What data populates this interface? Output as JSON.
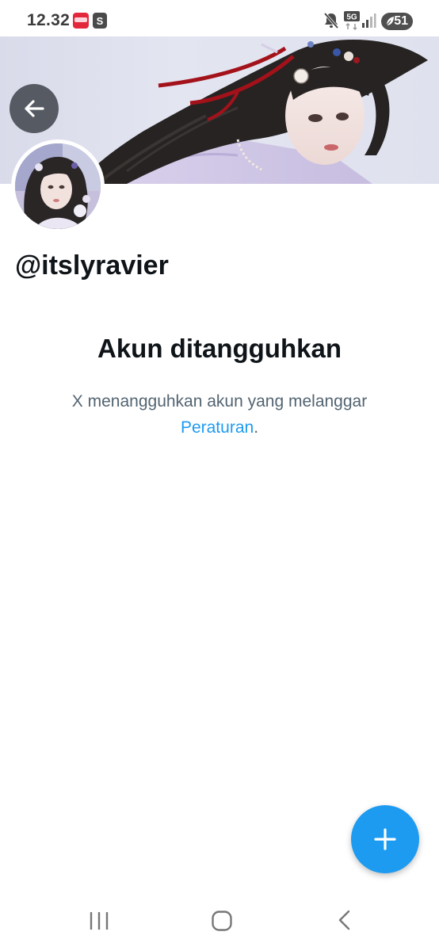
{
  "status_bar": {
    "time": "12.32",
    "notification_icons": [
      "news-app-icon",
      "shop-app-icon"
    ],
    "shop_icon_glyph": "S",
    "right_icons": [
      "mute-icon",
      "5g-network-icon",
      "signal-icon"
    ],
    "network_label": "5G",
    "battery_level": "51"
  },
  "profile": {
    "handle": "@itslyravier",
    "back_icon": "arrow-left-icon"
  },
  "suspension": {
    "title": "Akun ditangguhkan",
    "description_prefix": "X menangguhkan akun yang melanggar ",
    "link_text": "Peraturan",
    "description_suffix": "."
  },
  "fab": {
    "icon": "plus-icon"
  },
  "nav_bar": {
    "items": [
      "recents-icon",
      "home-icon",
      "back-icon"
    ]
  },
  "colors": {
    "accent": "#1d9bf0",
    "text_primary": "#0f1419",
    "text_secondary": "#536471",
    "back_button_bg": "#4b4e56"
  }
}
